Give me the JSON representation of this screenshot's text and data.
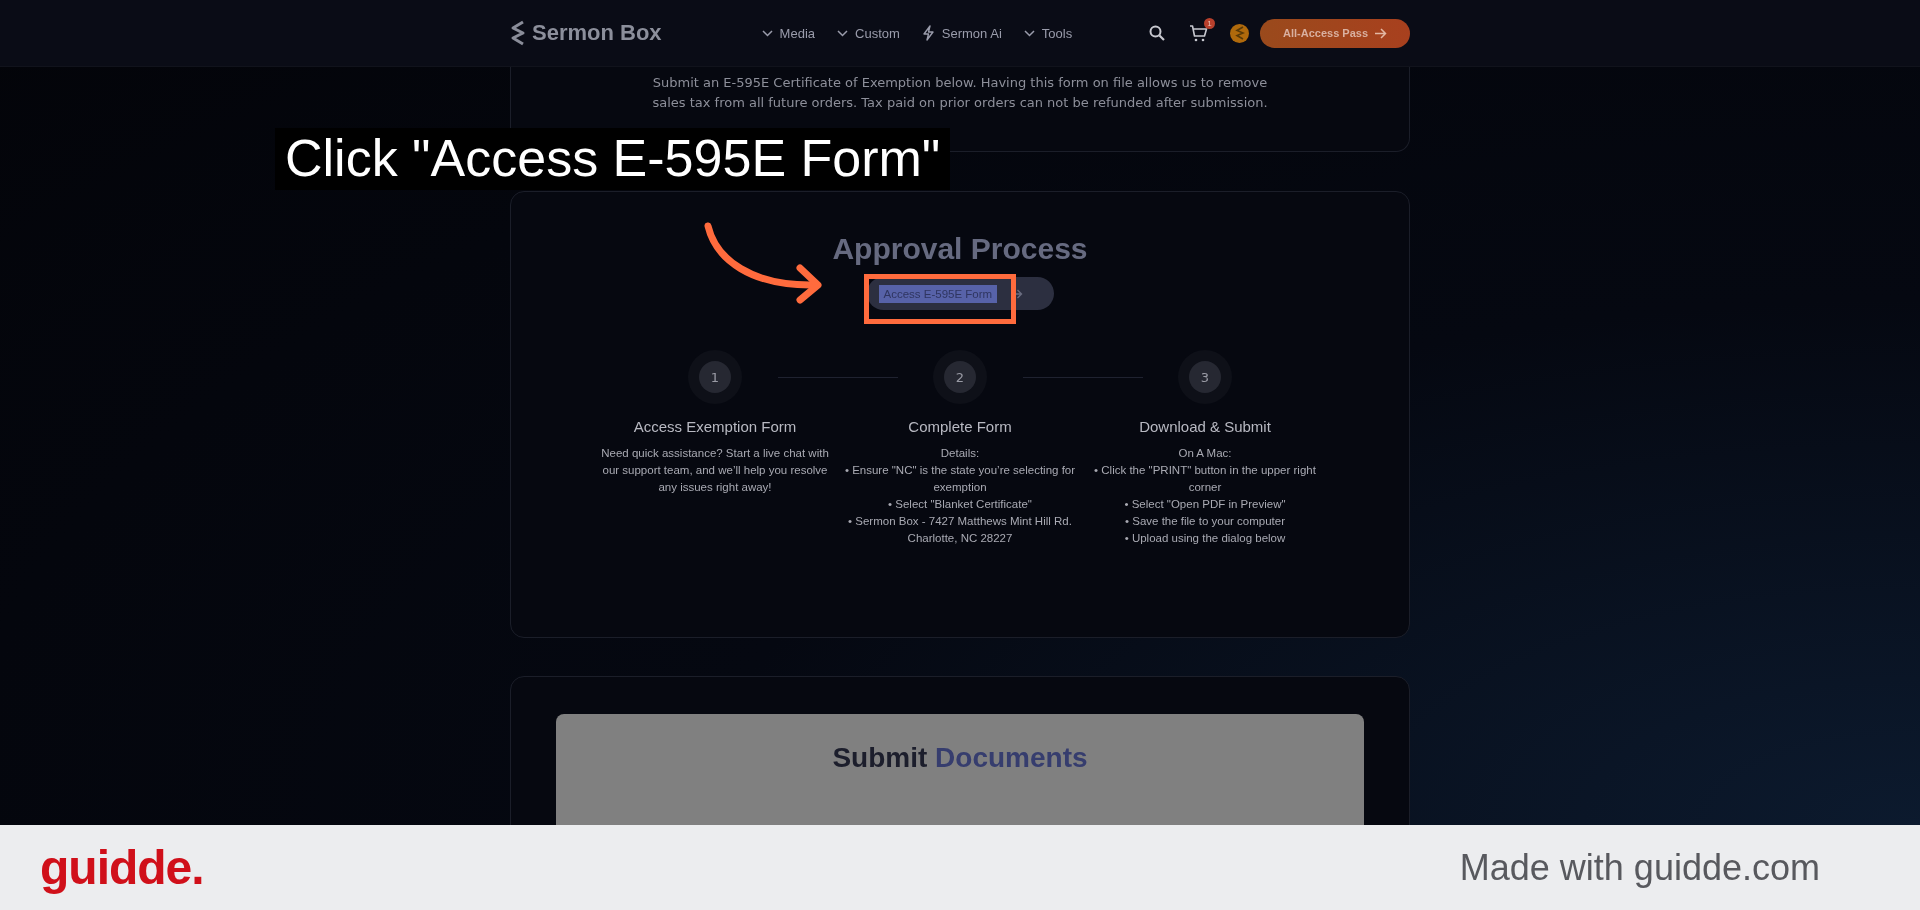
{
  "header": {
    "logo": "Sermon Box",
    "nav": [
      {
        "label": "Media",
        "kind": "dropdown"
      },
      {
        "label": "Custom",
        "kind": "dropdown"
      },
      {
        "label": "Sermon Ai",
        "kind": "bolt"
      },
      {
        "label": "Tools",
        "kind": "dropdown"
      }
    ],
    "cart_count": "1",
    "cta": "All-Access Pass"
  },
  "intro": {
    "text": "Submit an E-595E Certificate of Exemption below. Having this form on file allows us to remove sales tax from all future orders. Tax paid on prior orders can not be refunded after submission."
  },
  "approval": {
    "title": "Approval Process",
    "button": "Access E-595E Form",
    "steps": [
      {
        "number": "1",
        "title": "Access Exemption Form",
        "lines": [
          "Need quick assistance? Start a live chat with our support team, and we’ll help you resolve any issues right away!"
        ]
      },
      {
        "number": "2",
        "title": "Complete Form",
        "lines": [
          "Details:",
          "• Ensure \"NC\" is the state you’re selecting for exemption",
          "• Select \"Blanket Certificate\"",
          "• Sermon Box - 7427 Matthews Mint Hill Rd. Charlotte, NC 28227"
        ]
      },
      {
        "number": "3",
        "title": "Download & Submit",
        "lines": [
          "On A Mac:",
          "• Click the \"PRINT\" button in the upper right corner",
          "• Select \"Open PDF in Preview\"",
          "• Save the file to your computer",
          "• Upload using the dialog below"
        ]
      }
    ]
  },
  "submit": {
    "title_words": [
      "Submit",
      "Documents"
    ]
  },
  "tutorial": {
    "caption": "Click \"Access E-595E Form\""
  },
  "footer": {
    "brand": "guidde.",
    "credit": "Made with guidde.com"
  }
}
